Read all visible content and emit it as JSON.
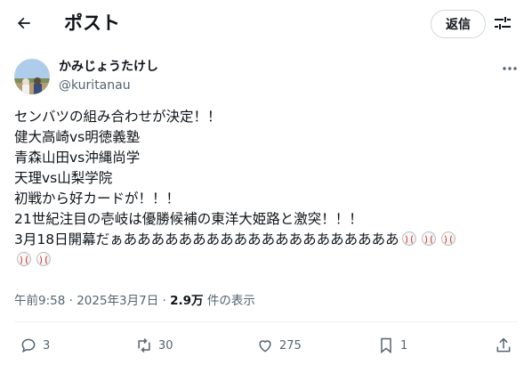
{
  "header": {
    "title": "ポスト",
    "reply_label": "返信"
  },
  "author": {
    "name": "かみじょうたけし",
    "handle": "@kuritanau"
  },
  "post": {
    "lines": [
      "センバツの組み合わせが決定！！",
      "健大高崎vs明徳義塾",
      "青森山田vs沖縄尚学",
      "天理vs山梨学院",
      "初戦から好カードが！！！",
      "21世紀注目の壱岐は優勝候補の東洋大姫路と激突！！！",
      "3月18日開幕だぁああああああああああああああああああああ"
    ],
    "emoji": "baseball"
  },
  "meta": {
    "time": "午前9:58",
    "sep": " · ",
    "date": "2025年3月7日",
    "sep2": " · ",
    "views": "2.9万",
    "views_label": " 件の表示"
  },
  "stats": {
    "replies": "3",
    "reposts": "30",
    "likes": "275",
    "bookmarks": "1"
  },
  "icons": [
    "back-arrow-icon",
    "filter-icon",
    "more-icon",
    "reply-icon",
    "repost-icon",
    "like-icon",
    "bookmark-icon",
    "share-icon"
  ]
}
